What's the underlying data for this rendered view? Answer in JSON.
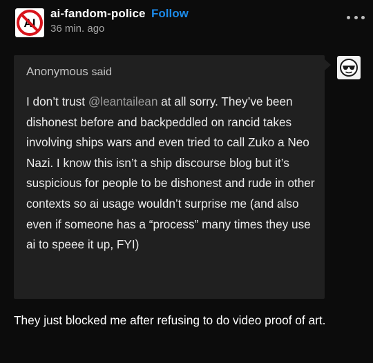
{
  "post": {
    "blog_name": "ai-fandom-police",
    "follow_label": "Follow",
    "timestamp": "36 min. ago",
    "avatar_text": "AI",
    "avatar_icon": "no-ai-icon",
    "more_icon": "ellipsis-icon"
  },
  "ask": {
    "asker_name": "Anonymous",
    "asker_said": "said",
    "anon_avatar_icon": "anonymous-sunglasses-icon",
    "question_before_mention": "I don’t trust ",
    "mention": "@leantailean",
    "question_after_mention": " at all sorry. They’ve been dishonest before and backpeddled on rancid takes involving ships wars and even tried to call Zuko a Neo Nazi. I know this isn’t a ship discourse blog but it’s suspicious for people to be dishonest and rude in other contexts so ai usage wouldn’t surprise me (and also even if someone has a “process” many times they use ai to speee it up, FYI)"
  },
  "answer": {
    "text": "They just blocked me after refusing to do video proof of art."
  },
  "colors": {
    "background": "#0c0c0c",
    "ask_box": "#202020",
    "follow": "#1c8ae8",
    "muted": "#a6a6a6",
    "no_symbol": "#d8141c"
  }
}
